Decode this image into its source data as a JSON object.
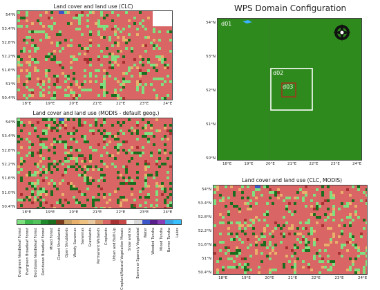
{
  "panels": {
    "clc": {
      "title": "Land cover and land use (CLC)",
      "lat_labels": [
        "54°N",
        "53.4°N",
        "52.8°N",
        "52.2°N",
        "51.6°N",
        "51°N",
        "50.4°N"
      ],
      "lon_labels": [
        "18°E",
        "19°E",
        "20°E",
        "21°E",
        "22°E",
        "23°E",
        "24°E"
      ]
    },
    "modis": {
      "title": "Land cover and land use (MODIS - default geog.)",
      "lat_labels": [
        "54°N",
        "53.4°N",
        "52.8°N",
        "52.2°N",
        "51.6°N",
        "51.0°N",
        "50.4°N"
      ],
      "lon_labels": [
        "18°E",
        "19°E",
        "20°E",
        "21°E",
        "22°E",
        "23°E",
        "24°E"
      ]
    },
    "wps": {
      "title": "WPS Domain Configuration",
      "lat_labels": [
        "54°N",
        "53°N",
        "52°N",
        "51°N",
        "50°N"
      ],
      "lon_labels": [
        "18°E",
        "19°E",
        "20°E",
        "21°E",
        "22°E",
        "23°E",
        "24°E"
      ],
      "domains": [
        "d01",
        "d02",
        "d03"
      ]
    },
    "clc_modis": {
      "title": "Land cover and land use (CLC, MODIS)",
      "lat_labels": [
        "54°N",
        "53.4°N",
        "52.8°N",
        "52.2°N",
        "51.6°N",
        "51°N",
        "50.4°N"
      ],
      "lon_labels": [
        "18°E",
        "19°E",
        "20°E",
        "21°E",
        "22°E",
        "23°E",
        "24°E"
      ]
    }
  },
  "legend": {
    "classes": [
      {
        "label": "Evergreen Needleleaf Forest",
        "color": "#7fe07f"
      },
      {
        "label": "Evergreen Broadleaf Forest",
        "color": "#3cb84a"
      },
      {
        "label": "Deciduous Needleleaf Forest",
        "color": "#52c35a"
      },
      {
        "label": "Deciduous Broadleaf Forest",
        "color": "#1f8a2c"
      },
      {
        "label": "Mixed Forest",
        "color": "#1b6e1e"
      },
      {
        "label": "Closed Shrublands",
        "color": "#7a3a1c"
      },
      {
        "label": "Open Shrublands",
        "color": "#c9a063"
      },
      {
        "label": "Woody Savannas",
        "color": "#e8b06a"
      },
      {
        "label": "Savannas",
        "color": "#f0c280"
      },
      {
        "label": "Grasslands",
        "color": "#e8c9a0"
      },
      {
        "label": "Permanent Wetlands",
        "color": "#d79a6a"
      },
      {
        "label": "Croplands",
        "color": "#d96565"
      },
      {
        "label": "Urban and Built-Up",
        "color": "#a83232"
      },
      {
        "label": "Cropland/Natural Vegetation Mosaic",
        "color": "#c84848"
      },
      {
        "label": "Snow and Ice",
        "color": "#f5f5f5"
      },
      {
        "label": "Barren or Sparsely Vegetated",
        "color": "#d8d8d8"
      },
      {
        "label": "Water",
        "color": "#3c55c8"
      },
      {
        "label": "Wooded Tundra",
        "color": "#5a1e8c"
      },
      {
        "label": "Mixed Tundra",
        "color": "#8a3cb4"
      },
      {
        "label": "Barren Tundra",
        "color": "#3aa0e0"
      },
      {
        "label": "Lakes",
        "color": "#36c0ff"
      }
    ]
  },
  "colors": {
    "crop": "#d96565",
    "forest": "#7fe07f",
    "dark_forest": "#1b6e1e",
    "wps_fill": "#2f8a1e",
    "d03_box": "#c02020"
  }
}
